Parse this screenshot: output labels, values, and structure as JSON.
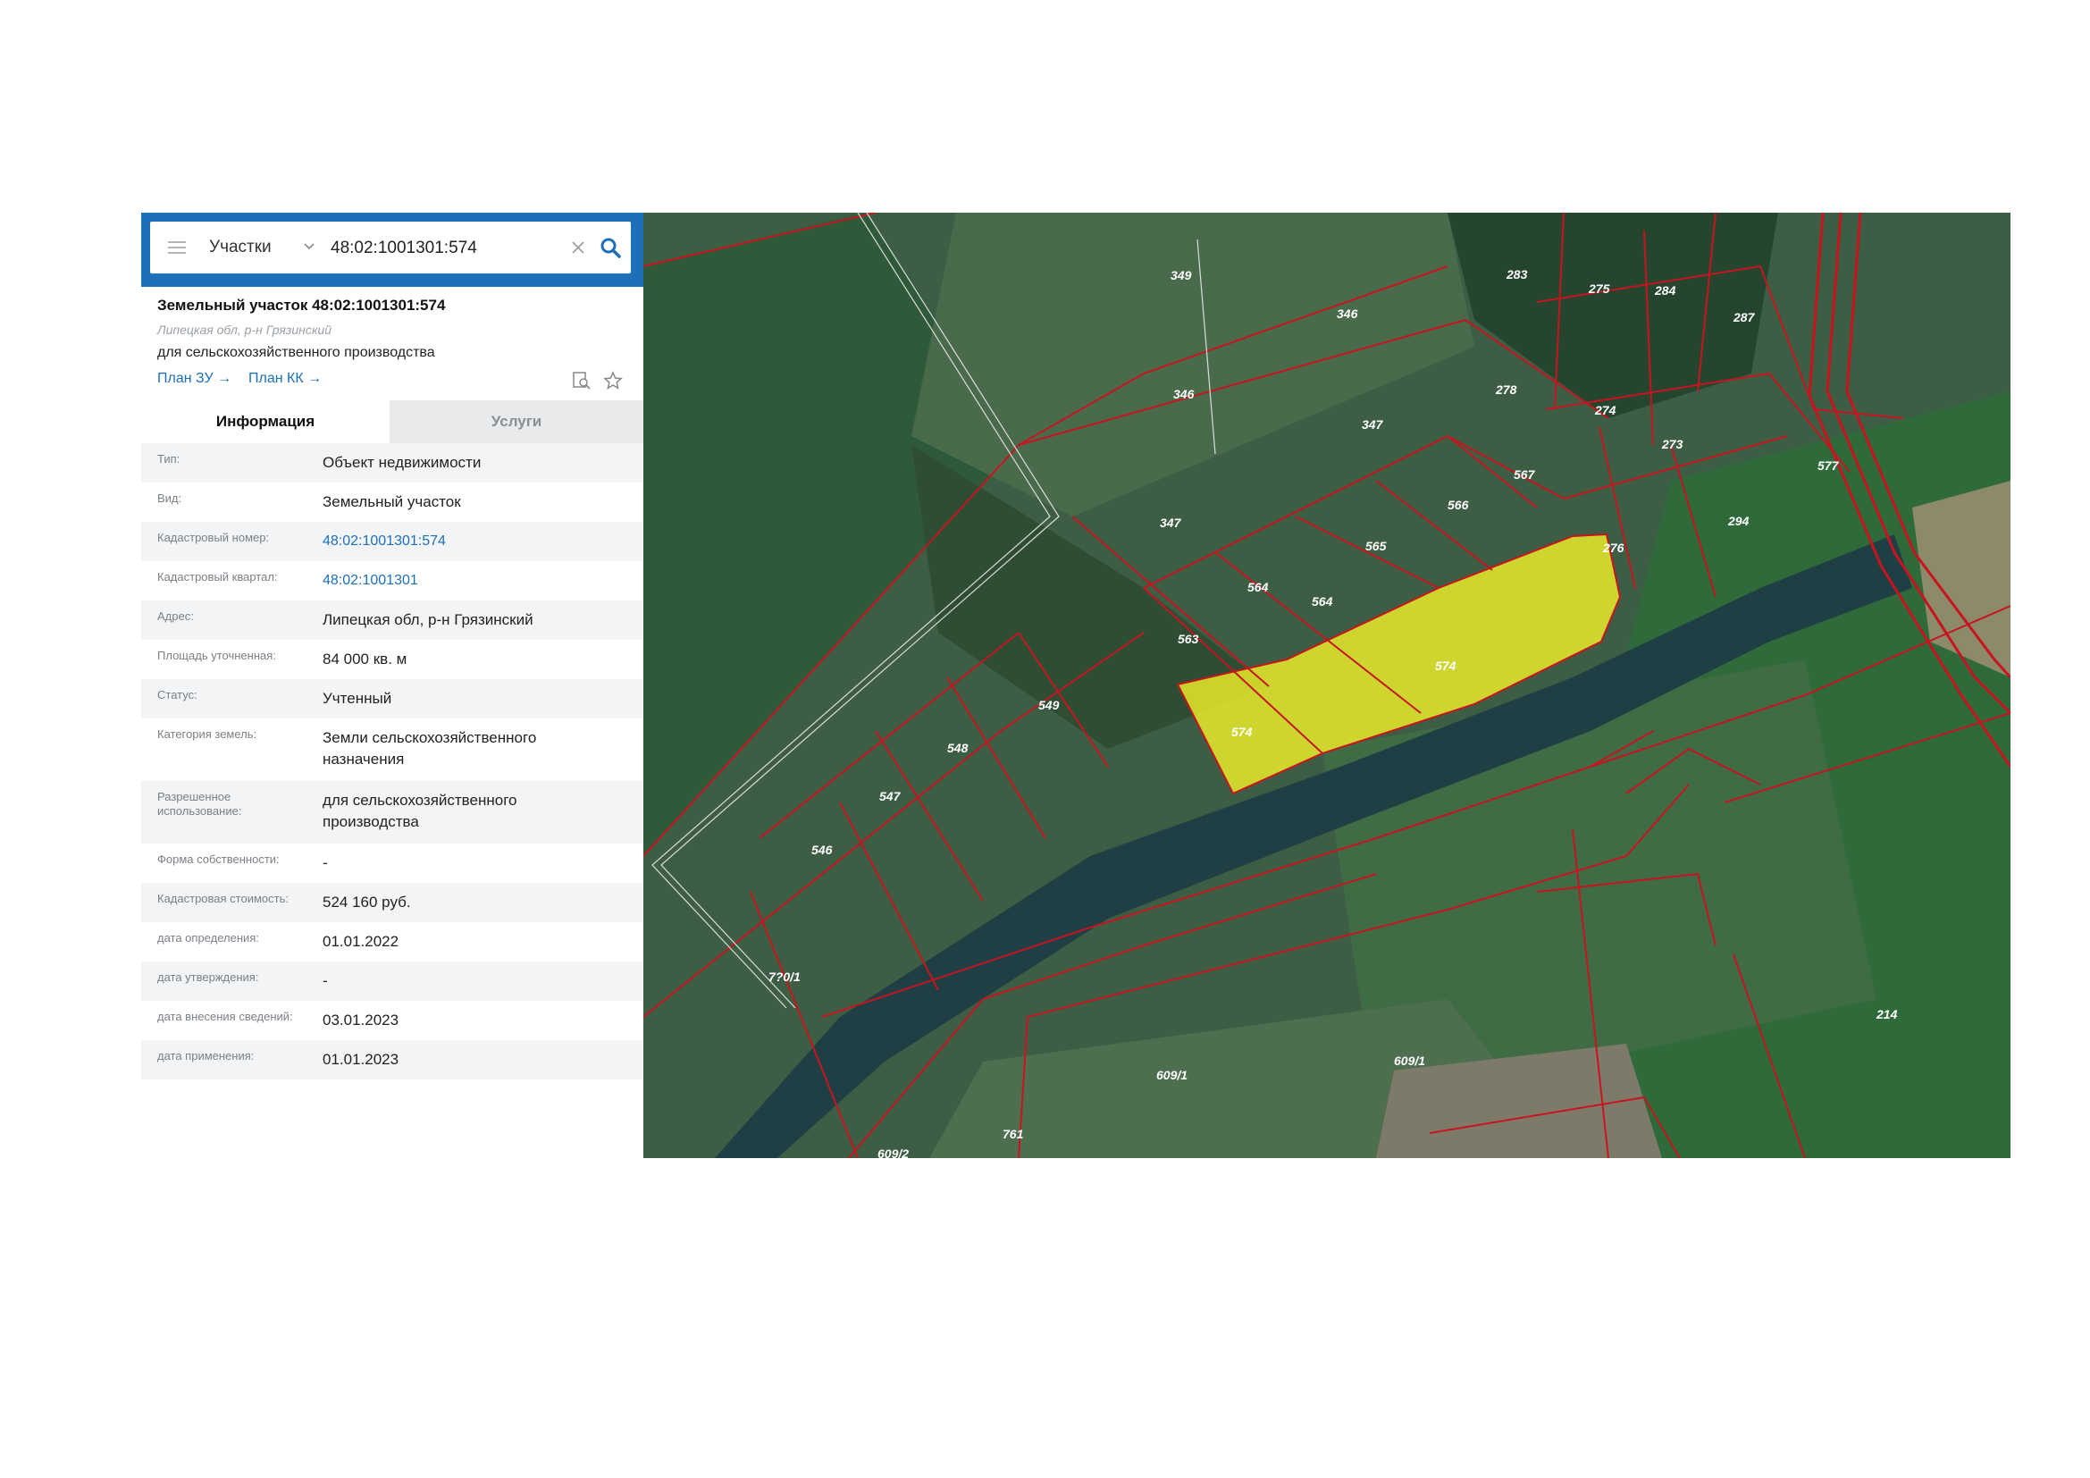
{
  "search": {
    "layer": "Участки",
    "query": "48:02:1001301:574"
  },
  "object": {
    "title": "Земельный участок 48:02:1001301:574",
    "address": "Липецкая обл, р-н Грязинский",
    "use": "для сельскохозяйственного производства",
    "links": [
      "План ЗУ →",
      "План КК →"
    ]
  },
  "tabs": [
    "Информация",
    "Услуги"
  ],
  "info": [
    {
      "label": "Тип:",
      "value": "Объект недвижимости"
    },
    {
      "label": "Вид:",
      "value": "Земельный участок"
    },
    {
      "label": "Кадастровый номер:",
      "value": "48:02:1001301:574"
    },
    {
      "label": "Кадастровый квартал:",
      "value": "48:02:1001301"
    },
    {
      "label": "Адрес:",
      "value": "Липецкая обл, р-н Грязинский"
    },
    {
      "label": "Площадь уточненная:",
      "value": "84 000 кв. м"
    },
    {
      "label": "Статус:",
      "value": "Учтенный"
    },
    {
      "label": "Категория земель:",
      "value": "Земли сельскохозяйственного назначения"
    },
    {
      "label": "Разрешенное использование:",
      "value": "для сельскохозяйственного производства"
    },
    {
      "label": "Форма собственности:",
      "value": "-"
    },
    {
      "label": "Кадастровая стоимость:",
      "value": "524 160 руб."
    },
    {
      "label": "дата определения:",
      "value": "01.01.2022"
    },
    {
      "label": "дата утверждения:",
      "value": "-"
    },
    {
      "label": "дата внесения сведений:",
      "value": "03.01.2023"
    },
    {
      "label": "дата применения:",
      "value": "01.01.2023"
    }
  ],
  "map": {
    "parcel_labels": [
      "349",
      "346",
      "283",
      "275",
      "284",
      "287",
      "346",
      "278",
      "274",
      "347",
      "273",
      "567",
      "566",
      "577",
      "347",
      "565",
      "276",
      "294",
      "564",
      "564",
      "563",
      "574",
      "574",
      "549",
      "548",
      "547",
      "546",
      "7?0/1",
      "214",
      "609/1",
      "609/1",
      "761",
      "609/2"
    ],
    "colors": {
      "boundary": "#c8141e",
      "selected_fill": "#e6ea2a",
      "river": "#203f44",
      "brand": "#1d6fb8"
    }
  }
}
